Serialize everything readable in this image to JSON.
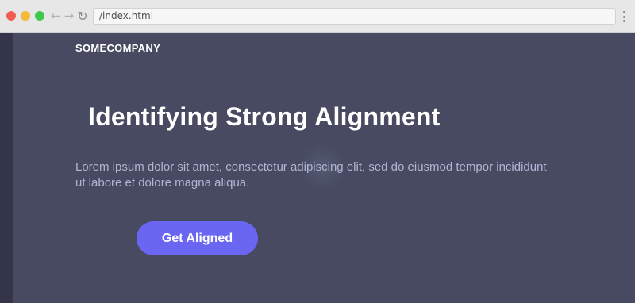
{
  "browser": {
    "url": "/index.html"
  },
  "page": {
    "brand": "SOMECOMPANY",
    "headline": "Identifying Strong Alignment",
    "body": "Lorem ipsum dolor sit amet, consectetur adipiscing elit, sed do eiusmod tempor incididunt ut labore et dolore magna aliqua.",
    "cta_label": "Get Aligned"
  },
  "colors": {
    "page_background": "#474a61",
    "accent": "#6b66f2",
    "body_text": "#b3b4d4"
  },
  "icons": {
    "back": "arrow-left-icon",
    "forward": "arrow-right-icon",
    "reload": "reload-icon",
    "menu": "kebab-menu-icon"
  }
}
